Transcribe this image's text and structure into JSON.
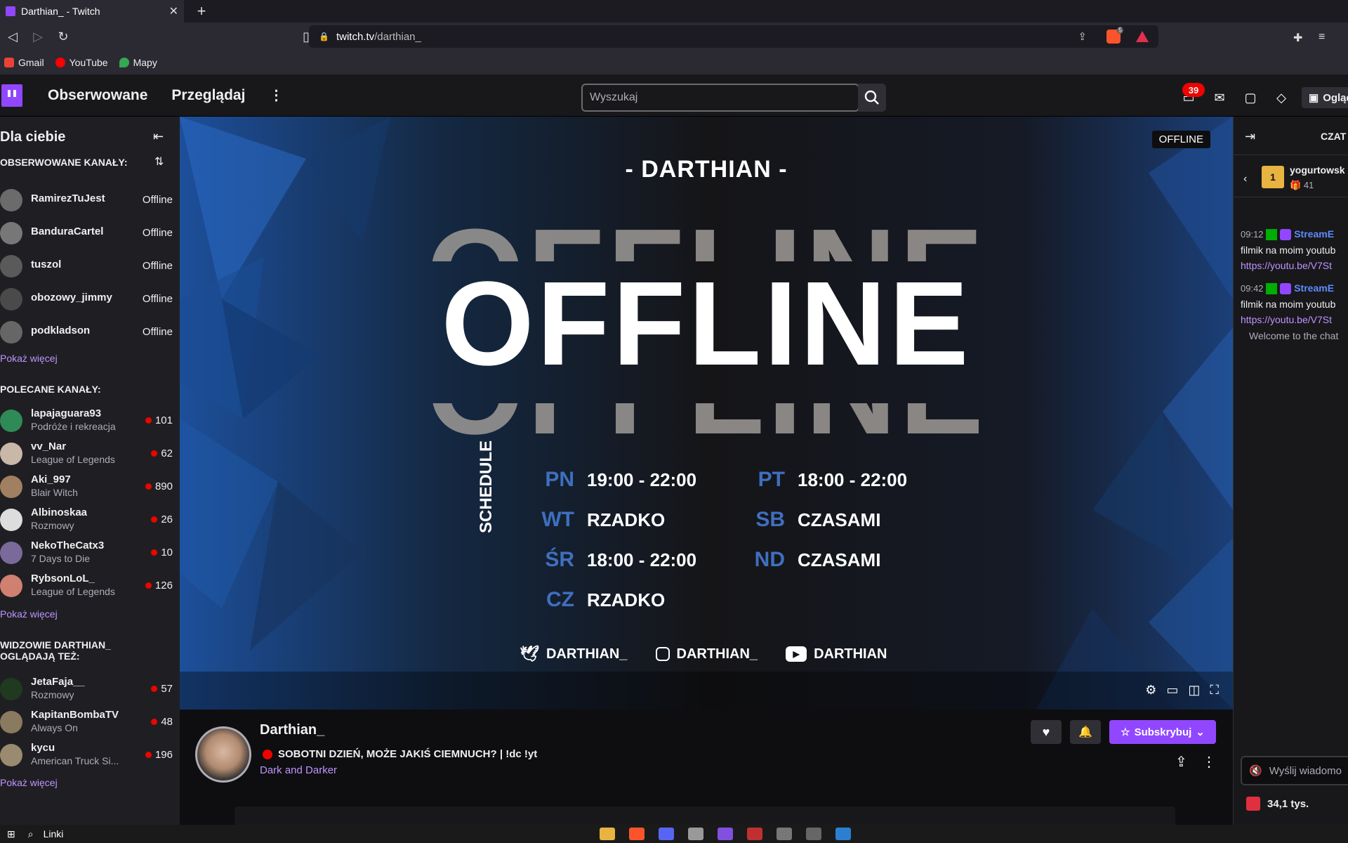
{
  "browser": {
    "tab_title": "Darthian_ - Twitch",
    "url_domain": "twitch.tv",
    "url_path": "/darthian_",
    "brave_badge": "5",
    "bookmarks": [
      {
        "label": "Gmail",
        "color": "#ea4335"
      },
      {
        "label": "YouTube",
        "color": "#ff0000"
      },
      {
        "label": "Mapy",
        "color": "#34a853"
      }
    ]
  },
  "topnav": {
    "following": "Obserwowane",
    "browse": "Przeglądaj",
    "search_placeholder": "Wyszukaj",
    "notif_count": "39",
    "watch_label": "Ogląd"
  },
  "sidebar": {
    "title": "Dla ciebie",
    "followed_heading": "OBSERWOWANE KANAŁY:",
    "followed": [
      {
        "name": "RamirezTuJest",
        "status": "Offline"
      },
      {
        "name": "BanduraCartel",
        "status": "Offline"
      },
      {
        "name": "tuszol",
        "status": "Offline"
      },
      {
        "name": "obozowy_jimmy",
        "status": "Offline"
      },
      {
        "name": "podkladson",
        "status": "Offline"
      }
    ],
    "show_more": "Pokaż więcej",
    "recommended_heading": "POLECANE KANAŁY:",
    "recommended": [
      {
        "name": "lapajaguara93",
        "game": "Podróże i rekreacja",
        "viewers": "101"
      },
      {
        "name": "vv_Nar",
        "game": "League of Legends",
        "viewers": "62"
      },
      {
        "name": "Aki_997",
        "game": "Blair Witch",
        "viewers": "890"
      },
      {
        "name": "Albinoskaa",
        "game": "Rozmowy",
        "viewers": "26"
      },
      {
        "name": "NekoTheCatx3",
        "game": "7 Days to Die",
        "viewers": "10"
      },
      {
        "name": "RybsonLoL_",
        "game": "League of Legends",
        "viewers": "126"
      }
    ],
    "viewers_heading": "WIDZOWIE DARTHIAN_ OGLĄDAJĄ TEŻ:",
    "viewers_also": [
      {
        "name": "JetaFaja__",
        "game": "Rozmowy",
        "viewers": "57"
      },
      {
        "name": "KapitanBombaTV",
        "game": "Always On",
        "viewers": "48"
      },
      {
        "name": "kycu",
        "game": "American Truck Si...",
        "viewers": "196"
      }
    ]
  },
  "player": {
    "offline_badge": "OFFLINE",
    "channel_title": "- DARTHIAN -",
    "offline_text": "OFFLINE",
    "schedule_label": "SCHEDULE",
    "schedule": [
      {
        "day": "PN",
        "time": "19:00 - 22:00"
      },
      {
        "day": "WT",
        "time": "RZADKO"
      },
      {
        "day": "ŚR",
        "time": "18:00 - 22:00"
      },
      {
        "day": "CZ",
        "time": "RZADKO"
      },
      {
        "day": "PT",
        "time": "18:00 - 22:00"
      },
      {
        "day": "SB",
        "time": "CZASAMI"
      },
      {
        "day": "ND",
        "time": "CZASAMI"
      }
    ],
    "socials": {
      "twitter": "DARTHIAN_",
      "instagram": "DARTHIAN_",
      "youtube": "DARTHIAN"
    }
  },
  "channel": {
    "name": "Darthian_",
    "stream_title": "SOBOTNI DZIEŃ, MOŻE JAKIŚ CIEMNUCH? | !dc !yt",
    "category": "Dark and Darker",
    "subscribe": "Subskrybuj"
  },
  "chat": {
    "header": "CZAT",
    "gift_user": "yogurtowsk",
    "gift_count": "41",
    "messages": [
      {
        "time": "09:12",
        "user": "StreamE",
        "text": "filmik na moim youtub",
        "link": "https://youtu.be/V7St"
      },
      {
        "time": "09:42",
        "user": "StreamE",
        "text": "filmik na moim youtub",
        "link": "https://youtu.be/V7St"
      }
    ],
    "welcome": "Welcome to the chat",
    "input_placeholder": "Wyślij wiadomo",
    "points": "34,1 tys."
  },
  "taskbar": {
    "links_label": "Linki"
  }
}
